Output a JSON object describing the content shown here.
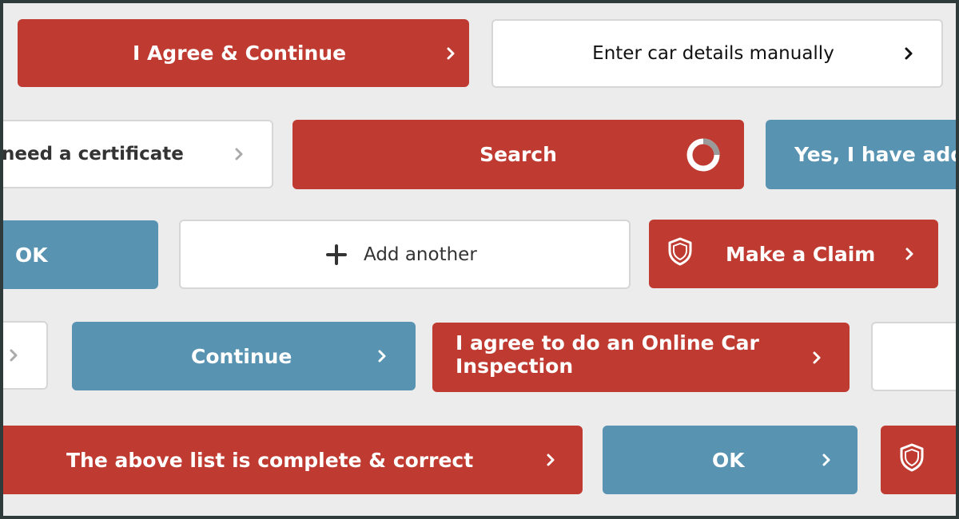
{
  "buttons": {
    "agree_continue": "I Agree & Continue",
    "enter_car_details": "Enter car details manually",
    "need_certificate": "need a certificate",
    "search": "Search",
    "yes_have_add": "Yes, I have add",
    "ok_row3": "OK",
    "add_another": "Add another",
    "make_claim": "Make a Claim",
    "continue": "Continue",
    "online_inspection_line1": "I agree to do an Online Car",
    "online_inspection_line2": "Inspection",
    "list_complete": "The above list is complete & correct",
    "ok_row5": "OK"
  },
  "colors": {
    "red": "#bf3a30",
    "blue": "#5893b1",
    "white": "#ffffff",
    "background": "#ececec",
    "frame": "#2f3b3b"
  },
  "icons": {
    "chevron": "chevron-right-icon",
    "plus": "plus-icon",
    "shield": "shield-icon",
    "spinner": "loading-spinner-icon"
  }
}
